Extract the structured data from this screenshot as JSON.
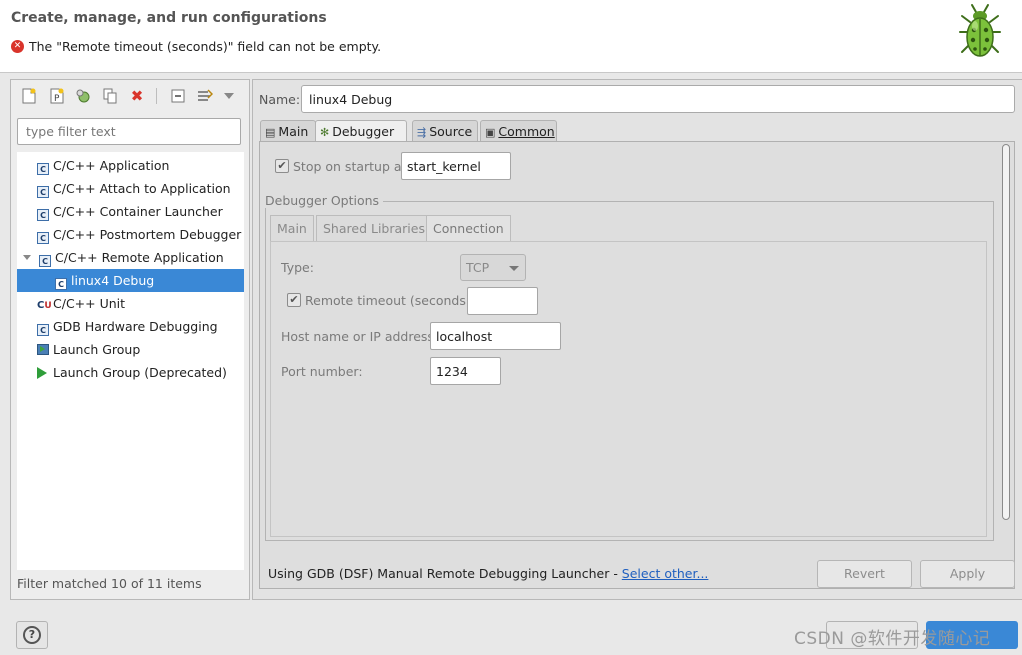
{
  "header": {
    "title": "Create, manage, and run configurations",
    "error_message": "The \"Remote timeout (seconds)\" field can not be empty."
  },
  "left_panel": {
    "filter_placeholder": "type filter text",
    "tree": [
      {
        "label": "C/C++ Application",
        "icon": "c-config-icon"
      },
      {
        "label": "C/C++ Attach to Application",
        "icon": "c-config-icon"
      },
      {
        "label": "C/C++ Container Launcher",
        "icon": "c-config-icon"
      },
      {
        "label": "C/C++ Postmortem Debugger",
        "icon": "c-config-icon"
      },
      {
        "label": "C/C++ Remote Application",
        "icon": "c-config-icon",
        "expanded": true
      },
      {
        "label": "linux4 Debug",
        "icon": "c-config-icon",
        "selected": true
      },
      {
        "label": "C/C++ Unit",
        "icon": "c-unit-icon"
      },
      {
        "label": "GDB Hardware Debugging",
        "icon": "c-config-icon"
      },
      {
        "label": "Launch Group",
        "icon": "launch-group-icon"
      },
      {
        "label": "Launch Group (Deprecated)",
        "icon": "run-arrow-icon"
      }
    ],
    "status": "Filter matched 10 of 11 items"
  },
  "right_panel": {
    "name_label": "Name:",
    "name_value": "linux4 Debug",
    "tabs": [
      "Main",
      "Debugger",
      "Source",
      "Common"
    ],
    "active_tab": "Debugger",
    "stop_on_startup_label": "Stop on startup at:",
    "stop_on_startup_value": "start_kernel",
    "debugger_options_label": "Debugger Options",
    "subtabs": [
      "Main",
      "Shared Libraries",
      "Connection"
    ],
    "active_subtab": "Connection",
    "connection": {
      "type_label": "Type:",
      "type_value": "TCP",
      "remote_timeout_label": "Remote timeout (seconds):",
      "remote_timeout_value": "",
      "host_label": "Host name or IP address:",
      "host_value": "localhost",
      "port_label": "Port number:",
      "port_value": "1234"
    },
    "launcher_text": "Using GDB (DSF) Manual Remote Debugging Launcher - ",
    "select_other": "Select other...",
    "revert_label": "Revert",
    "apply_label": "Apply"
  },
  "watermark": "CSDN @软件开发随心记",
  "colors": {
    "accent": "#3a88d6",
    "error": "#d9342b",
    "link": "#1f5fbf"
  }
}
